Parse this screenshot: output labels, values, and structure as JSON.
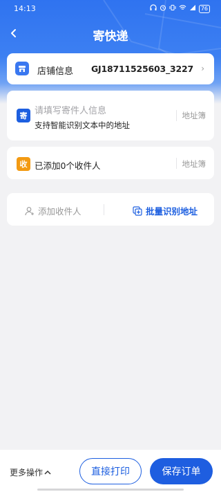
{
  "status_bar": {
    "time": "14:13",
    "battery": "76",
    "icons": [
      "headphones-icon",
      "alarm-icon",
      "vibrate-icon",
      "wifi-icon",
      "signal-icon",
      "battery-icon"
    ]
  },
  "header": {
    "title": "寄快递",
    "back_icon": "back-chevron-icon",
    "gradient_top": "#2f73f0"
  },
  "store": {
    "label": "店铺信息",
    "value": "GJ18711525603_3227",
    "icon": "store-icon",
    "chevron": "›"
  },
  "sender": {
    "badge": "寄",
    "placeholder": "请填写寄件人信息",
    "hint": "支持智能识别文本中的地址",
    "address_book": "地址簿",
    "badge_color": "#1d5fe0"
  },
  "receiver": {
    "badge": "收",
    "text": "已添加0个收件人",
    "address_book": "地址簿",
    "badge_color": "#f39a12"
  },
  "actions": {
    "add_receiver": "添加收件人",
    "batch_recognize": "批量识别地址"
  },
  "bottom": {
    "more_ops": "更多操作",
    "print": "直接打印",
    "save": "保存订单",
    "accent": "#1e5ee0"
  }
}
